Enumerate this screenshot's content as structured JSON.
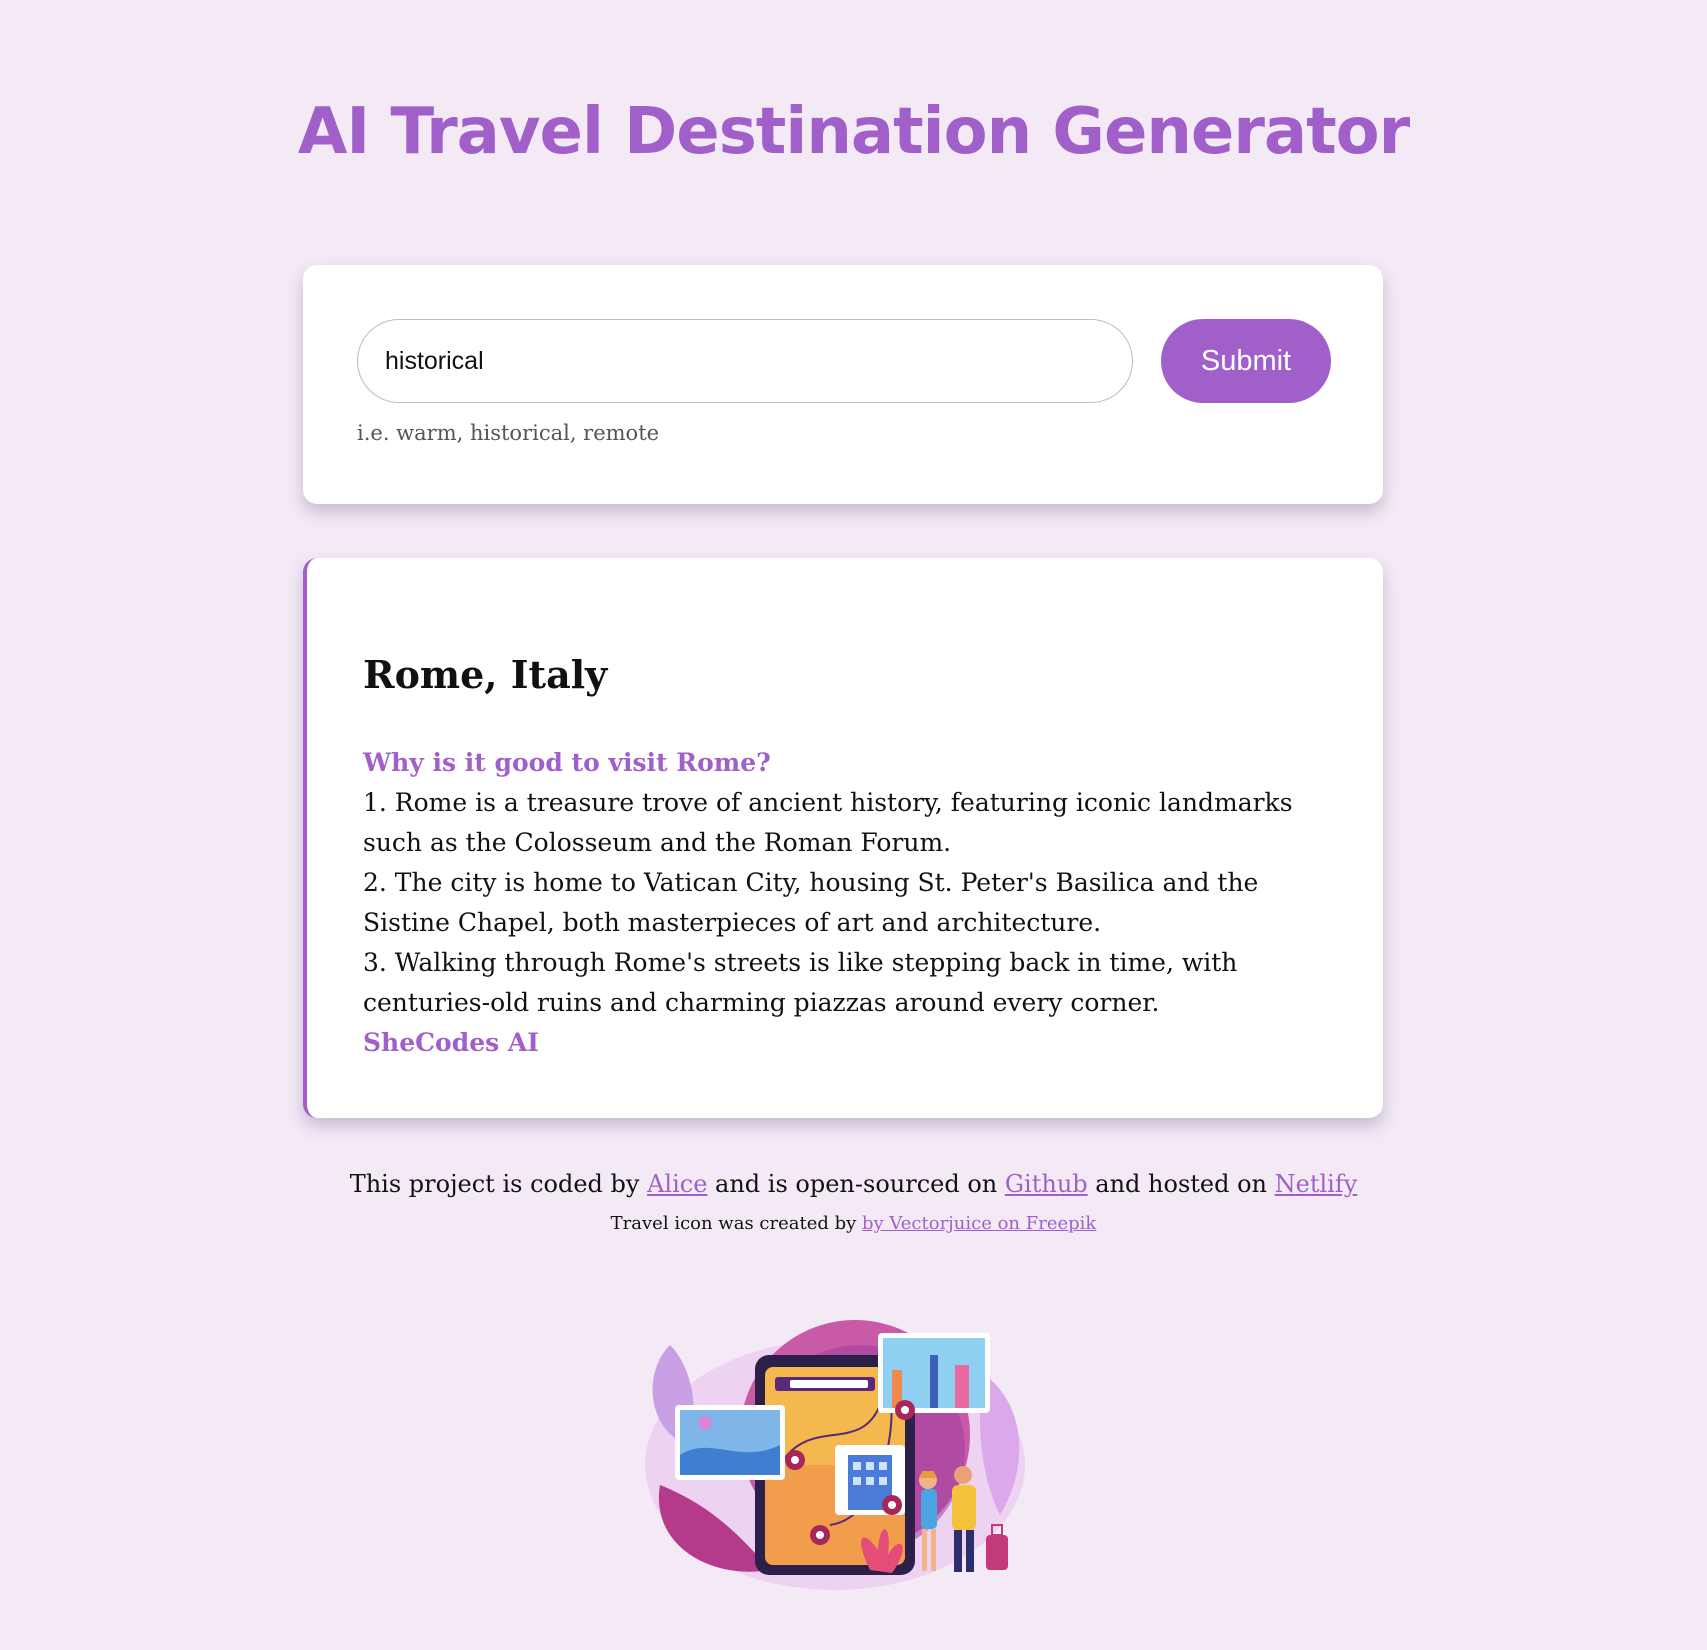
{
  "header": {
    "title": "AI Travel Destination Generator"
  },
  "search": {
    "value": "historical",
    "hint": "i.e. warm, historical, remote",
    "submit_label": "Submit"
  },
  "result": {
    "title": "Rome, Italy",
    "question": "Why is it good to visit Rome?",
    "lines": [
      "1. Rome is a treasure trove of ancient history, featuring iconic landmarks such as the Colosseum and the Roman Forum.",
      "2. The city is home to Vatican City, housing St. Peter's Basilica and the Sistine Chapel, both masterpieces of art and architecture.",
      "3. Walking through Rome's streets is like stepping back in time, with centuries-old ruins and charming piazzas around every corner."
    ],
    "signature": "SheCodes AI"
  },
  "footer": {
    "text_1": "This project is coded by ",
    "author_link": "Alice",
    "text_2": " and is open-sourced on ",
    "github_link": "Github",
    "text_3": " and hosted on ",
    "netlify_link": "Netlify",
    "credit_text": "Travel icon was created by ",
    "credit_link": "by Vectorjuice on Freepik"
  },
  "colors": {
    "accent": "#a160c9",
    "background": "#f3eaf6"
  },
  "illustration": {
    "icon": "travel-illustration-icon"
  }
}
